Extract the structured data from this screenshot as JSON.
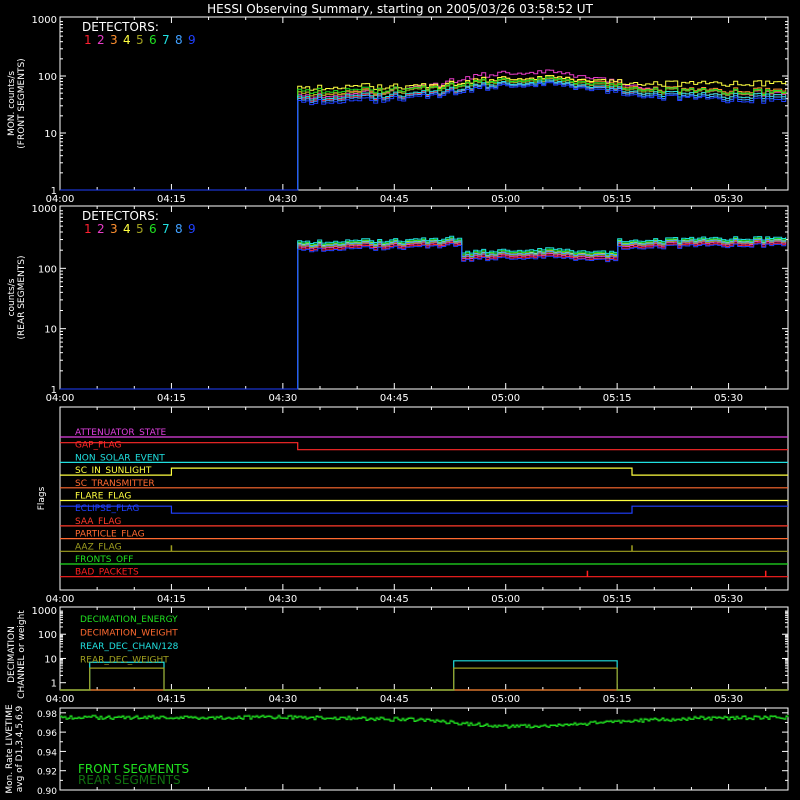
{
  "title": "HESSI Observing Summary, starting on 2005/03/26 03:58:52 UT",
  "colors": {
    "background": "#000000",
    "axes": "#ffffff",
    "detectors": [
      "#ff2030",
      "#e83cc8",
      "#ff9030",
      "#ffff40",
      "#a0a020",
      "#20e020",
      "#20e0e0",
      "#40a0ff",
      "#2040ff"
    ]
  },
  "chart_data": [
    {
      "id": "front",
      "type": "line",
      "ylabel": "MON. counts/s",
      "ylabel2": "(FRONT SEGMENTS)",
      "yscale": "log",
      "ylim": [
        1,
        1000
      ],
      "xlim": [
        "04:00",
        "05:38"
      ],
      "xticks": [
        "04:00",
        "04:15",
        "04:30",
        "04:45",
        "05:00",
        "05:15",
        "05:30"
      ],
      "ytick_labels": [
        "1",
        "10",
        "100",
        "1000"
      ],
      "legend_title": "DETECTORS:",
      "legend_labels": [
        "1",
        "2",
        "3",
        "4",
        "5",
        "6",
        "7",
        "8",
        "9"
      ],
      "x": [
        "04:00",
        "04:32",
        "04:32",
        "04:40",
        "04:50",
        "04:55",
        "05:00",
        "05:05",
        "05:10",
        "05:15",
        "05:20",
        "05:25",
        "05:30",
        "05:38"
      ],
      "series": [
        {
          "values": [
            1,
            1,
            40,
            42,
            50,
            62,
            75,
            80,
            70,
            58,
            50,
            46,
            44,
            44
          ]
        },
        {
          "values": [
            1,
            1,
            45,
            47,
            70,
            95,
            115,
            120,
            105,
            80,
            60,
            52,
            50,
            48
          ]
        },
        {
          "values": [
            1,
            1,
            50,
            52,
            65,
            80,
            92,
            95,
            88,
            72,
            60,
            56,
            55,
            55
          ]
        },
        {
          "values": [
            1,
            1,
            62,
            65,
            68,
            80,
            92,
            95,
            90,
            80,
            75,
            72,
            72,
            75
          ]
        },
        {
          "values": [
            1,
            1,
            50,
            50,
            60,
            72,
            82,
            85,
            78,
            65,
            55,
            52,
            50,
            50
          ]
        },
        {
          "values": [
            1,
            1,
            55,
            56,
            62,
            75,
            86,
            90,
            82,
            68,
            58,
            54,
            52,
            52
          ]
        },
        {
          "values": [
            1,
            1,
            42,
            44,
            52,
            64,
            76,
            80,
            72,
            60,
            50,
            46,
            44,
            44
          ]
        },
        {
          "values": [
            1,
            1,
            38,
            40,
            48,
            60,
            72,
            76,
            68,
            56,
            46,
            42,
            40,
            40
          ]
        },
        {
          "values": [
            1,
            1,
            35,
            36,
            45,
            56,
            68,
            72,
            64,
            52,
            43,
            40,
            37,
            36
          ]
        }
      ]
    },
    {
      "id": "rear",
      "type": "line",
      "ylabel": "counts/s",
      "ylabel2": "(REAR SEGMENTS)",
      "yscale": "log",
      "ylim": [
        1,
        1000
      ],
      "xlim": [
        "04:00",
        "05:38"
      ],
      "xticks": [
        "04:00",
        "04:15",
        "04:30",
        "04:45",
        "05:00",
        "05:15",
        "05:30"
      ],
      "ytick_labels": [
        "1",
        "10",
        "100",
        "1000"
      ],
      "legend_title": "DETECTORS:",
      "legend_labels": [
        "1",
        "2",
        "3",
        "4",
        "5",
        "6",
        "7",
        "8",
        "9"
      ],
      "x": [
        "04:00",
        "04:32",
        "04:32",
        "04:40",
        "04:50",
        "04:54",
        "04:54",
        "05:00",
        "05:05",
        "05:10",
        "05:15",
        "05:15",
        "05:25",
        "05:38"
      ],
      "series": [
        {
          "values": [
            1,
            1,
            210,
            220,
            240,
            260,
            140,
            155,
            160,
            150,
            140,
            230,
            240,
            250
          ]
        },
        {
          "values": [
            1,
            1,
            225,
            235,
            255,
            275,
            150,
            165,
            170,
            160,
            150,
            245,
            255,
            265
          ]
        },
        {
          "values": [
            1,
            1,
            240,
            250,
            270,
            290,
            160,
            175,
            180,
            170,
            160,
            260,
            270,
            280
          ]
        },
        {
          "values": [
            1,
            1,
            250,
            260,
            280,
            300,
            165,
            180,
            188,
            178,
            168,
            270,
            280,
            290
          ]
        },
        {
          "values": [
            1,
            1,
            235,
            245,
            265,
            285,
            158,
            172,
            178,
            168,
            158,
            255,
            265,
            275
          ]
        },
        {
          "values": [
            1,
            1,
            260,
            270,
            290,
            310,
            175,
            190,
            198,
            188,
            175,
            280,
            290,
            300
          ]
        },
        {
          "values": [
            1,
            1,
            275,
            285,
            305,
            330,
            185,
            200,
            210,
            198,
            185,
            295,
            305,
            315
          ]
        },
        {
          "values": [
            1,
            1,
            245,
            255,
            275,
            295,
            162,
            178,
            184,
            174,
            164,
            265,
            275,
            285
          ]
        },
        {
          "values": [
            1,
            1,
            200,
            210,
            230,
            250,
            135,
            148,
            152,
            145,
            135,
            220,
            230,
            240
          ]
        }
      ]
    },
    {
      "id": "flags",
      "type": "line",
      "ylabel": "Flags",
      "xlim": [
        "04:00",
        "05:38"
      ],
      "xticks": [
        "04:00",
        "04:15",
        "04:30",
        "04:45",
        "05:00",
        "05:15",
        "05:30"
      ],
      "flags": [
        {
          "name": "ATTENUATOR_STATE",
          "color": "#e040e0",
          "segments": [
            [
              "04:00",
              0
            ]
          ]
        },
        {
          "name": "GAP_FLAG",
          "color": "#ff2a2a",
          "segments": [
            [
              "04:00",
              1
            ],
            [
              "04:32",
              0
            ]
          ]
        },
        {
          "name": "NON_SOLAR_EVENT",
          "color": "#20e0e0",
          "segments": [
            [
              "04:00",
              0
            ]
          ]
        },
        {
          "name": "SC_IN_SUNLIGHT",
          "color": "#ffff40",
          "segments": [
            [
              "04:00",
              0
            ],
            [
              "04:15",
              1
            ],
            [
              "05:17",
              0
            ]
          ]
        },
        {
          "name": "SC_TRANSMITTER",
          "color": "#ff6a30",
          "segments": [
            [
              "04:00",
              0
            ]
          ]
        },
        {
          "name": "FLARE_FLAG",
          "color": "#ffff40",
          "segments": [
            [
              "04:00",
              0
            ]
          ]
        },
        {
          "name": "ECLIPSE_FLAG",
          "color": "#2040ff",
          "segments": [
            [
              "04:00",
              1
            ],
            [
              "04:15",
              0
            ],
            [
              "05:17",
              1
            ]
          ]
        },
        {
          "name": "SAA_FLAG",
          "color": "#ff3a2a",
          "segments": [
            [
              "04:00",
              0
            ]
          ]
        },
        {
          "name": "PARTICLE_FLAG",
          "color": "#ff6a30",
          "segments": [
            [
              "04:00",
              0
            ]
          ]
        },
        {
          "name": "AAZ_FLAG",
          "color": "#a0a020",
          "spikes": [
            "04:15",
            "05:17"
          ]
        },
        {
          "name": "FRONTS_OFF",
          "color": "#20e020",
          "segments": [
            [
              "04:00",
              0
            ]
          ]
        },
        {
          "name": "BAD_PACKETS",
          "color": "#ff2020",
          "spikes": [
            "05:11",
            "05:35"
          ]
        }
      ]
    },
    {
      "id": "decimation",
      "type": "line",
      "ylabel": "DECIMATION",
      "ylabel2": "CHANNEL or weight",
      "yscale": "log",
      "ylim": [
        0.5,
        1000
      ],
      "xlim": [
        "04:00",
        "05:38"
      ],
      "xticks": [
        "04:00",
        "04:15",
        "04:30",
        "04:45",
        "05:00",
        "05:15",
        "05:30"
      ],
      "ytick_labels": [
        "1",
        "10",
        "100",
        "1000"
      ],
      "legend_labels": [
        "DECIMATION_ENERGY",
        "DECIMATION_WEIGHT",
        "REAR_DEC_CHAN/128",
        "REAR_DEC_WEIGHT"
      ],
      "legend_colors": [
        "#20e020",
        "#ff6a30",
        "#20e0e0",
        "#a0a020"
      ],
      "series": [
        {
          "name": "DECIMATION_ENERGY",
          "x": [
            "04:00",
            "05:38"
          ],
          "values": [
            0.5,
            0.5
          ]
        },
        {
          "name": "DECIMATION_WEIGHT",
          "x": [
            "04:00",
            "05:38"
          ],
          "values": [
            0.5,
            0.5
          ]
        },
        {
          "name": "REAR_DEC_CHAN/128",
          "x": [
            "04:00",
            "04:04",
            "04:04",
            "04:14",
            "04:14",
            "04:53",
            "04:53",
            "05:15",
            "05:15",
            "05:38"
          ],
          "values": [
            0.5,
            0.5,
            7,
            7,
            0.5,
            0.5,
            8,
            8,
            0.5,
            0.5
          ]
        },
        {
          "name": "REAR_DEC_WEIGHT",
          "x": [
            "04:00",
            "04:04",
            "04:04",
            "04:14",
            "04:14",
            "04:53",
            "04:53",
            "05:15",
            "05:15",
            "05:38"
          ],
          "values": [
            0.5,
            0.5,
            4,
            4,
            0.5,
            0.5,
            4,
            4,
            0.5,
            0.5
          ]
        }
      ]
    },
    {
      "id": "livetime",
      "type": "line",
      "ylabel": "Mon. Rate LIVETIME",
      "ylabel2": "avg of D1,3,4,5,6,9",
      "ylim": [
        0.9,
        0.985
      ],
      "xlim": [
        "04:00",
        "05:38"
      ],
      "ytick_labels": [
        "0.90",
        "0.92",
        "0.94",
        "0.96",
        "0.98"
      ],
      "legend_labels": [
        "FRONT SEGMENTS",
        "REAR SEGMENTS"
      ],
      "legend_colors": [
        "#20e020",
        "#107010"
      ],
      "series": [
        {
          "name": "FRONT SEGMENTS",
          "x": [
            "04:00",
            "04:15",
            "04:30",
            "04:40",
            "04:50",
            "04:55",
            "05:00",
            "05:05",
            "05:10",
            "05:15",
            "05:25",
            "05:38"
          ],
          "values": [
            0.975,
            0.975,
            0.975,
            0.974,
            0.972,
            0.968,
            0.966,
            0.966,
            0.968,
            0.971,
            0.974,
            0.975
          ]
        },
        {
          "name": "REAR SEGMENTS",
          "x": [
            "04:00",
            "04:15",
            "04:30",
            "04:40",
            "04:50",
            "04:55",
            "05:00",
            "05:05",
            "05:10",
            "05:15",
            "05:25",
            "05:38"
          ],
          "values": [
            0.976,
            0.976,
            0.976,
            0.975,
            0.973,
            0.969,
            0.967,
            0.967,
            0.969,
            0.972,
            0.975,
            0.976
          ]
        }
      ]
    }
  ]
}
